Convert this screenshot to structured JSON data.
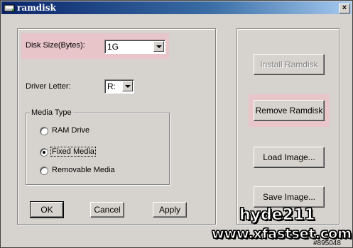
{
  "window": {
    "title": "ramdisk",
    "close_glyph": "×"
  },
  "disk_size": {
    "label": "Disk Size(Bytes):",
    "value": "1G"
  },
  "driver_letter": {
    "label": "Driver Letter:",
    "value": "R:"
  },
  "media_type": {
    "title": "Media Type",
    "options": [
      {
        "label": "RAM Drive",
        "selected": false
      },
      {
        "label": "Fixed Media",
        "selected": true
      },
      {
        "label": "Removable Media",
        "selected": false
      }
    ]
  },
  "buttons": {
    "ok": "OK",
    "cancel": "Cancel",
    "apply": "Apply",
    "install": "Install Ramdisk",
    "remove": "Remove Ramdisk",
    "load": "Load Image...",
    "save": "Save Image..."
  },
  "watermark": {
    "line1": "hyde211",
    "line2": "www.xfastset.com",
    "id": "#895048"
  },
  "colors": {
    "highlight": "#e7c5c9",
    "title_bar": "#0a246a",
    "face": "#d6d3ce"
  }
}
